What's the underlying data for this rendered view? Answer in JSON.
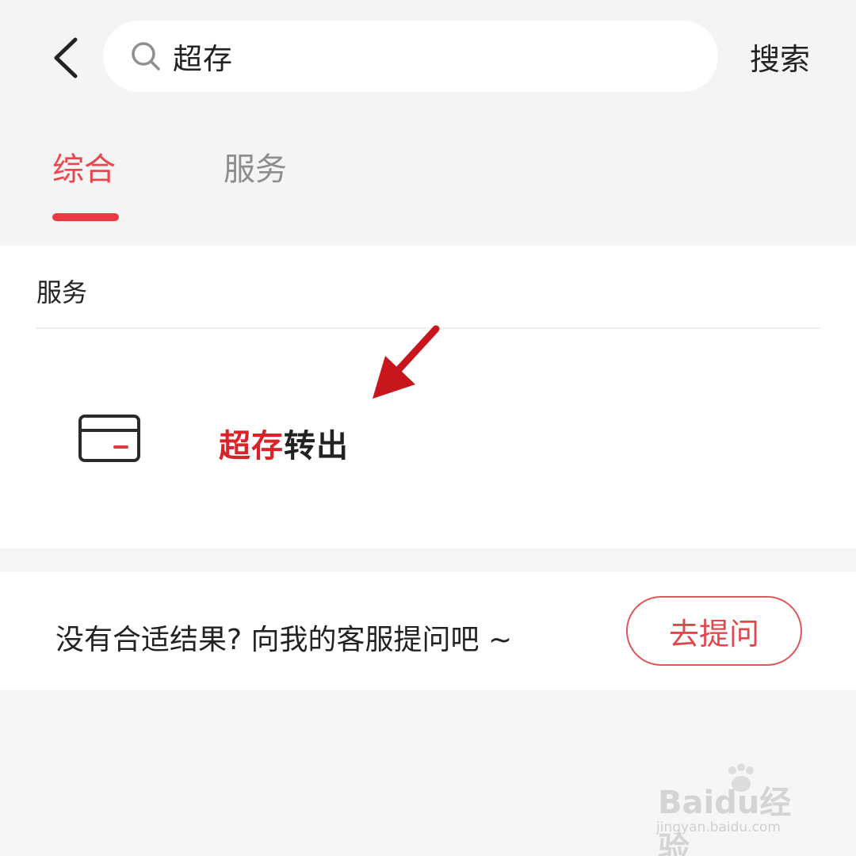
{
  "header": {
    "search_query": "超存",
    "search_button_label": "搜索"
  },
  "tabs": [
    {
      "label": "综合",
      "active": true
    },
    {
      "label": "服务",
      "active": false
    }
  ],
  "services_section": {
    "title": "服务",
    "items": [
      {
        "name_highlight": "超存",
        "name_rest": "转出",
        "icon": "card-icon"
      }
    ]
  },
  "prompt": {
    "text": "没有合适结果? 向我的客服提问吧 ~",
    "button_label": "去提问"
  },
  "watermark": {
    "logo_text": "Baidu经验",
    "url": "jingyan.baidu.com"
  },
  "colors": {
    "accent": "#e8474b",
    "highlight": "#d9232a",
    "annotation_arrow": "#c8161d"
  }
}
